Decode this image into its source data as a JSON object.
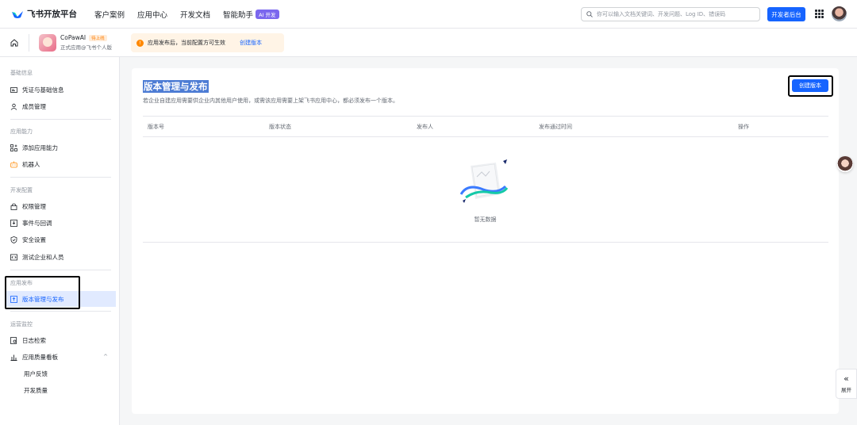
{
  "topbar": {
    "brand": "飞书开放平台",
    "nav": [
      "客户案例",
      "应用中心",
      "开发文档",
      "智能助手"
    ],
    "ai_badge": "AI 开发",
    "search_placeholder": "你可以输入文档关键词、开发问题、Log ID、错误码",
    "dev_console": "开发者后台"
  },
  "subbar": {
    "app_name": "CoPawAI",
    "app_status": "待上线",
    "app_sub": "正式应用@飞书个人版",
    "notice_text": "应用发布后，当前配置方可生效",
    "notice_link": "创建版本"
  },
  "sidebar": {
    "groups": [
      {
        "title": "基础信息",
        "items": [
          "凭证与基础信息",
          "成员管理"
        ]
      },
      {
        "title": "应用能力",
        "items": [
          "添加应用能力",
          "机器人"
        ]
      },
      {
        "title": "开发配置",
        "items": [
          "权限管理",
          "事件与回调",
          "安全设置",
          "测试企业和人员"
        ]
      },
      {
        "title": "应用发布",
        "items": [
          "版本管理与发布"
        ]
      },
      {
        "title": "运营监控",
        "items": [
          "日志检索",
          "应用质量看板",
          "用户反馈",
          "开发质量"
        ]
      }
    ]
  },
  "main": {
    "title": "版本管理与发布",
    "description": "若企业自建应用需要供企业内其他用户使用，或需该应用需要上架飞书应用中心，都必须发布一个版本。",
    "create_button": "创建版本",
    "columns": [
      "版本号",
      "版本状态",
      "发布人",
      "发布通过时间",
      "操作"
    ],
    "empty_text": "暂无数据"
  },
  "float": {
    "expand_label": "展开"
  },
  "colors": {
    "primary": "#1664ff",
    "warning": "#ff8800",
    "active_bg": "#e1eaff"
  }
}
